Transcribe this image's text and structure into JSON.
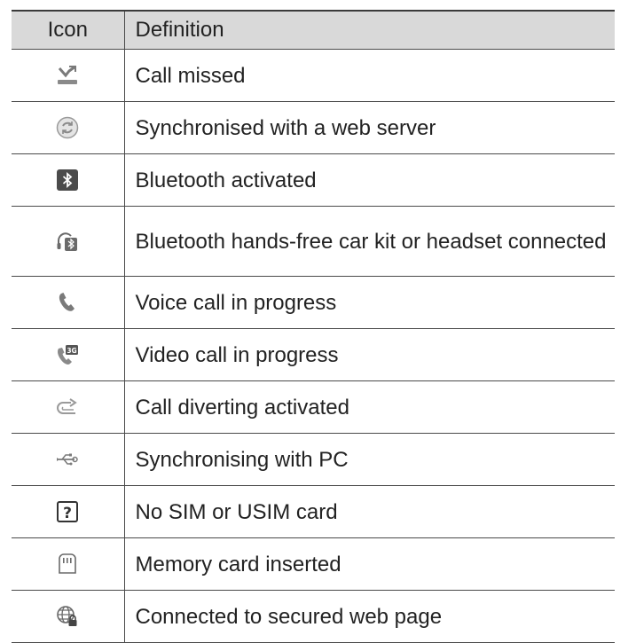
{
  "table": {
    "header": {
      "icon": "Icon",
      "definition": "Definition"
    },
    "rows": [
      {
        "icon": "call-missed-icon",
        "definition": "Call missed"
      },
      {
        "icon": "sync-web-icon",
        "definition": "Synchronised with a web server"
      },
      {
        "icon": "bluetooth-icon",
        "definition": "Bluetooth activated"
      },
      {
        "icon": "bluetooth-headset-icon",
        "definition": "Bluetooth hands-free car kit or headset connected"
      },
      {
        "icon": "voice-call-icon",
        "definition": "Voice call in progress"
      },
      {
        "icon": "video-call-icon",
        "definition": "Video call in progress"
      },
      {
        "icon": "call-divert-icon",
        "definition": "Call diverting activated"
      },
      {
        "icon": "usb-sync-icon",
        "definition": "Synchronising with PC"
      },
      {
        "icon": "no-sim-icon",
        "definition": "No SIM or USIM card"
      },
      {
        "icon": "memory-card-icon",
        "definition": "Memory card inserted"
      },
      {
        "icon": "secure-web-icon",
        "definition": "Connected to secured web page"
      }
    ]
  }
}
